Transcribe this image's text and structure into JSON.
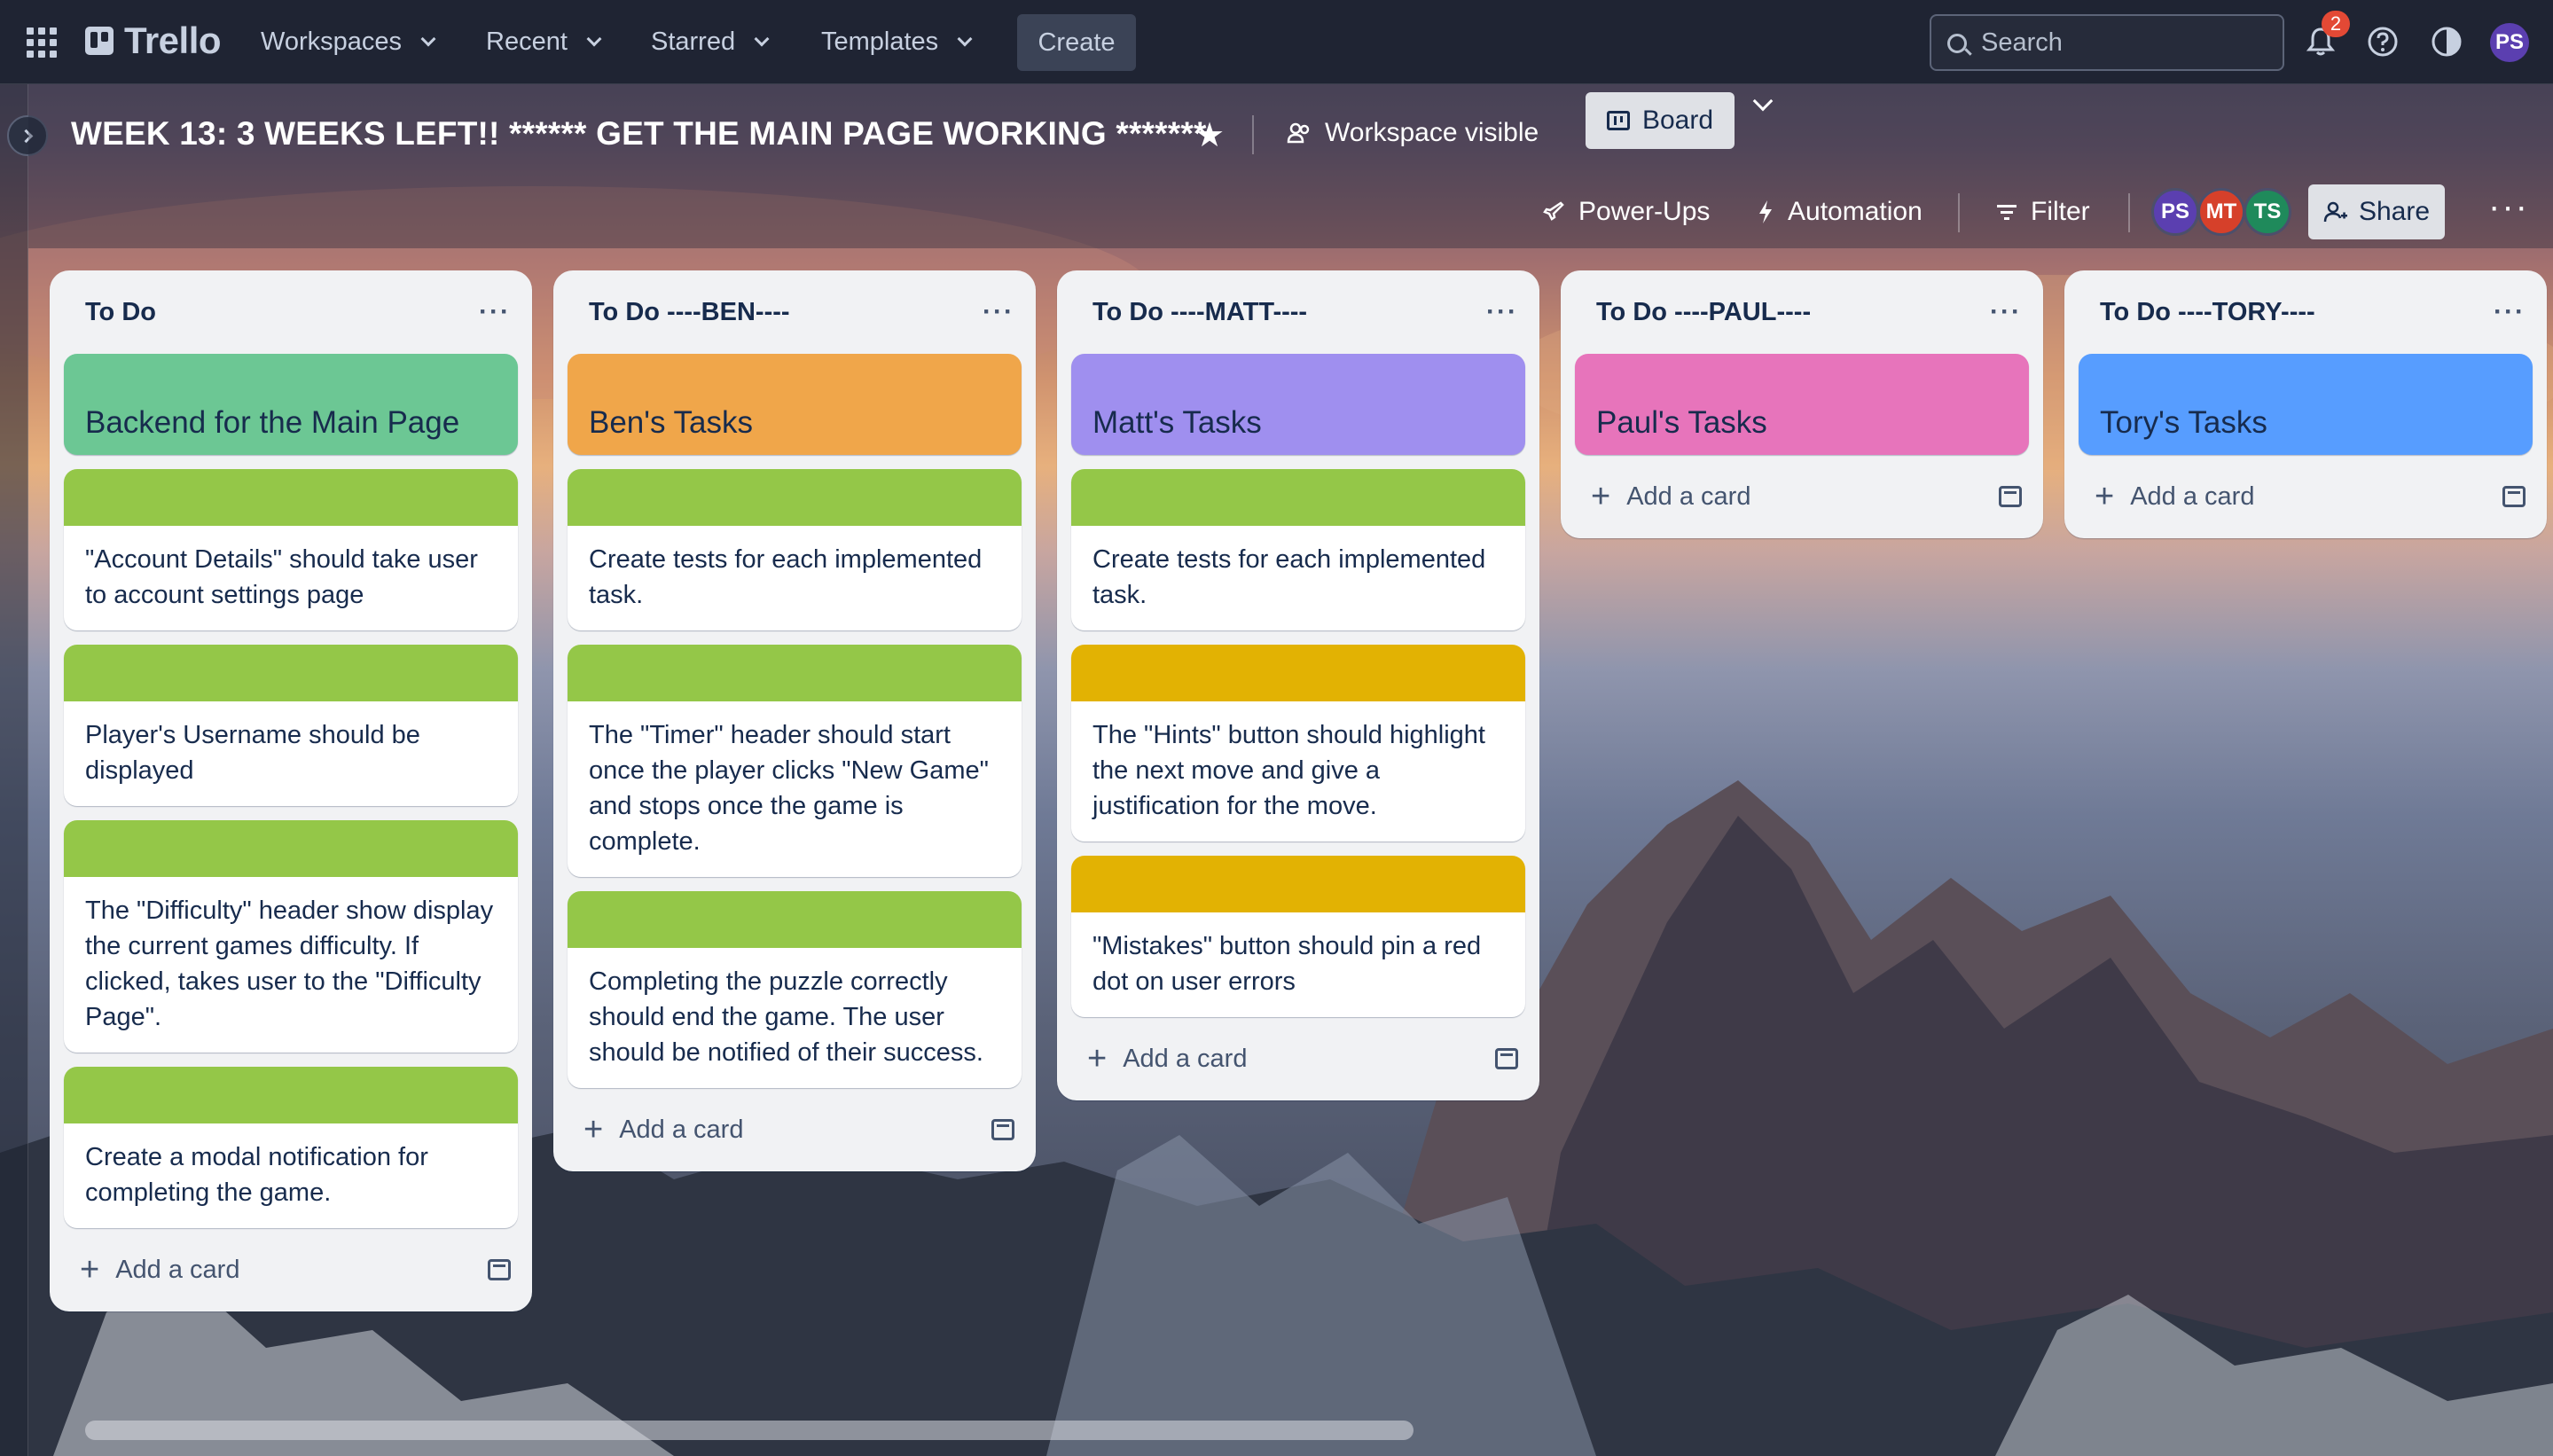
{
  "topnav": {
    "logo": "Trello",
    "menus": [
      "Workspaces",
      "Recent",
      "Starred",
      "Templates"
    ],
    "create_label": "Create",
    "search_placeholder": "Search",
    "notification_count": "2",
    "user_initials": "PS"
  },
  "board": {
    "title": "WEEK 13: 3 WEEKS LEFT!! ****** GET THE MAIN PAGE WORKING *******",
    "visibility_label": "Workspace visible",
    "view_label": "Board",
    "powerups_label": "Power-Ups",
    "automation_label": "Automation",
    "filter_label": "Filter",
    "share_label": "Share",
    "members": [
      {
        "initials": "PS",
        "color": "#5b3fb0"
      },
      {
        "initials": "MT",
        "color": "#d6402a"
      },
      {
        "initials": "TS",
        "color": "#1f8a5b"
      }
    ]
  },
  "lists": [
    {
      "title": "To Do",
      "header_card": {
        "label": "Backend for the Main Page",
        "color": "#6cc794"
      },
      "cards": [
        {
          "text": "\"Account Details\" should take user to account settings page",
          "cover": "#94c748"
        },
        {
          "text": "Player's Username should be displayed",
          "cover": "#94c748"
        },
        {
          "text": "The \"Difficulty\" header show display the current games difficulty. If clicked, takes user to the \"Difficulty Page\".",
          "cover": "#94c748"
        },
        {
          "text": "Create a modal notification for completing the game.",
          "cover": "#94c748"
        }
      ],
      "add_label": "Add a card"
    },
    {
      "title": "To Do ----BEN----",
      "header_card": {
        "label": "Ben's Tasks",
        "color": "#f0a64a"
      },
      "cards": [
        {
          "text": "Create tests for each implemented task.",
          "cover": "#94c748"
        },
        {
          "text": "The \"Timer\" header should start once the player clicks \"New Game\" and stops once the game is complete.",
          "cover": "#94c748"
        },
        {
          "text": "Completing the puzzle correctly should end the game. The user should be notified of their success.",
          "cover": "#94c748"
        }
      ],
      "add_label": "Add a card"
    },
    {
      "title": "To Do ----MATT----",
      "header_card": {
        "label": "Matt's Tasks",
        "color": "#9f8fef"
      },
      "cards": [
        {
          "text": "Create tests for each implemented task.",
          "cover": "#94c748"
        },
        {
          "text": "The \"Hints\" button should highlight the next move and give a justification for the move.",
          "cover": "#e2b203"
        },
        {
          "text": "\"Mistakes\" button should pin a red dot on user errors",
          "cover": "#e2b203"
        }
      ],
      "add_label": "Add a card"
    },
    {
      "title": "To Do ----PAUL----",
      "header_card": {
        "label": "Paul's Tasks",
        "color": "#e774bb"
      },
      "cards": [],
      "add_label": "Add a card"
    },
    {
      "title": "To Do ----TORY----",
      "header_card": {
        "label": "Tory's Tasks",
        "color": "#579dff"
      },
      "cards": [],
      "add_label": "Add a card"
    }
  ]
}
